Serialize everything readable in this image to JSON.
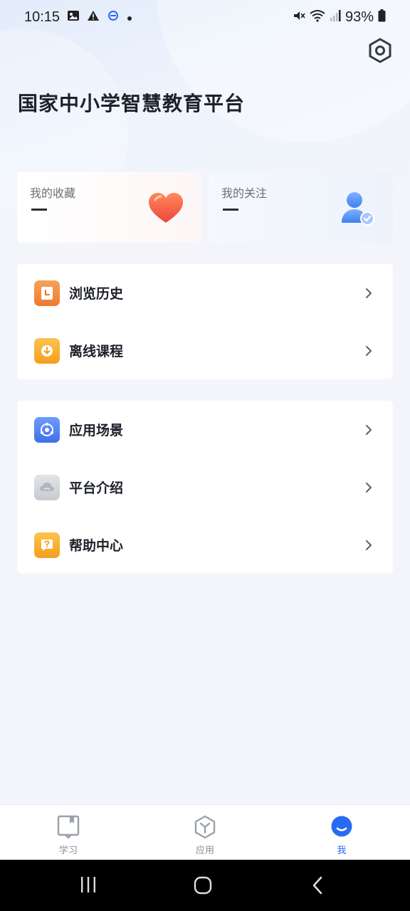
{
  "status_bar": {
    "time": "10:15",
    "battery": "93%",
    "icons_left": [
      "image-icon",
      "alert-icon",
      "app-badge-icon",
      "dot-icon"
    ],
    "icons_right": [
      "mute-icon",
      "wifi-icon",
      "signal-icon",
      "battery-icon"
    ]
  },
  "header": {
    "title": "国家中小学智慧教育平台",
    "settings_icon": "settings-hex-icon"
  },
  "stats": [
    {
      "label": "我的收藏",
      "value": "—",
      "icon": "heart-icon",
      "color": "#f35a3a"
    },
    {
      "label": "我的关注",
      "value": "—",
      "icon": "user-check-icon",
      "color": "#3f7ff0"
    }
  ],
  "menu_group_1": [
    {
      "label": "浏览历史",
      "icon": "history-icon",
      "color": "#f08a3c"
    },
    {
      "label": "离线课程",
      "icon": "download-icon",
      "color": "#f7a829"
    }
  ],
  "menu_group_2": [
    {
      "label": "应用场景",
      "icon": "scene-icon",
      "color": "#4b7bf2"
    },
    {
      "label": "平台介绍",
      "icon": "cloud-icon",
      "color": "#c9cbd1"
    },
    {
      "label": "帮助中心",
      "icon": "help-icon",
      "color": "#f7a829"
    }
  ],
  "bottom_nav": [
    {
      "label": "学习",
      "icon": "book-icon",
      "active": false
    },
    {
      "label": "应用",
      "icon": "cube-icon",
      "active": false
    },
    {
      "label": "我",
      "icon": "profile-icon",
      "active": true
    }
  ],
  "colors": {
    "accent": "#2a6af0",
    "background": "#f3f5fa"
  }
}
